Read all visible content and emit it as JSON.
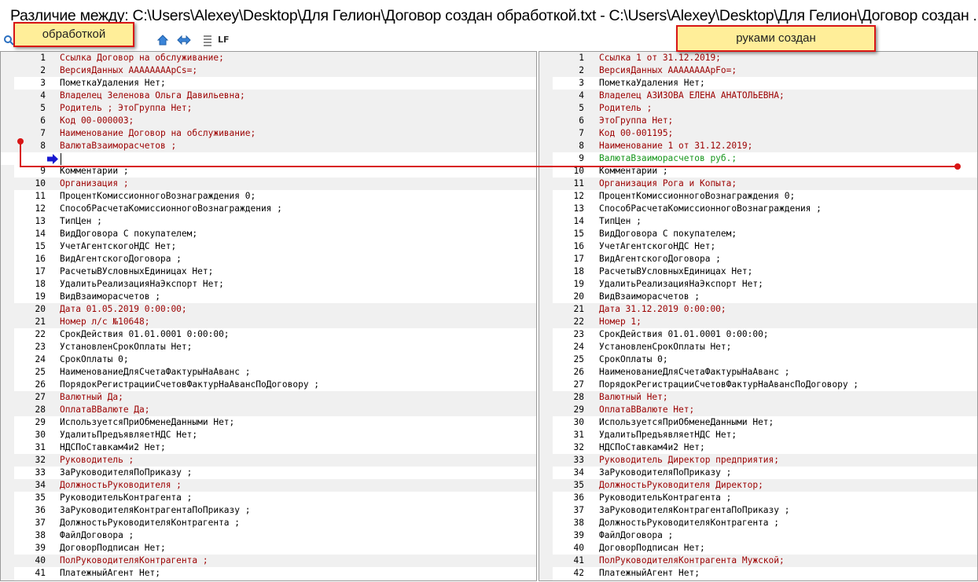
{
  "window": {
    "title": "Различие между: C:\\Users\\Alexey\\Desktop\\Для Гелион\\Договор создан обработкой.txt - C:\\Users\\Alexey\\Desktop\\Для Гелион\\Договор создан ..."
  },
  "toolbar": {
    "lf_label": "LF",
    "icons": [
      "search-icon",
      "home-icon",
      "sync-icon",
      "list-icon"
    ]
  },
  "callouts": {
    "left": "обработкой",
    "right": "руками создан"
  },
  "colors": {
    "diff_text": "#9c0000",
    "added_text": "#16961b",
    "diff_bg": "#f0f0f0",
    "callout_bg": "#ffee99",
    "callout_border": "#d81616",
    "marker_line": "#d81616",
    "cursor_arrow": "#1818d0"
  },
  "left_pane": {
    "lines": [
      {
        "num": "1",
        "text": "Ссылка Договор на обслуживание;",
        "state": "diff"
      },
      {
        "num": "2",
        "text": "ВерсияДанных AAAAAAAApCs=;",
        "state": "diff"
      },
      {
        "num": "3",
        "text": "ПометкаУдаления Нет;",
        "state": "same"
      },
      {
        "num": "4",
        "text": "Владелец Зеленова Ольга Давильевна;",
        "state": "diff"
      },
      {
        "num": "5",
        "text": "Родитель ; ЭтоГруппа Нет;",
        "state": "diff"
      },
      {
        "num": "6",
        "text": "Код 00-000003;",
        "state": "diff"
      },
      {
        "num": "7",
        "text": "Наименование Договор на обслуживание;",
        "state": "diff"
      },
      {
        "num": "8",
        "text": "ВалютаВзаиморасчетов ;",
        "state": "diff"
      },
      {
        "num": "",
        "text": "",
        "state": "blank"
      },
      {
        "num": "9",
        "text": "Комментарии ;",
        "state": "same"
      },
      {
        "num": "10",
        "text": "Организация ;",
        "state": "diff"
      },
      {
        "num": "11",
        "text": "ПроцентКомиссионногоВознаграждения 0;",
        "state": "same"
      },
      {
        "num": "12",
        "text": "СпособРасчетаКомиссионногоВознаграждения ;",
        "state": "same"
      },
      {
        "num": "13",
        "text": "ТипЦен ;",
        "state": "same"
      },
      {
        "num": "14",
        "text": "ВидДоговора С покупателем;",
        "state": "same"
      },
      {
        "num": "15",
        "text": "УчетАгентскогоНДС Нет;",
        "state": "same"
      },
      {
        "num": "16",
        "text": "ВидАгентскогоДоговора ;",
        "state": "same"
      },
      {
        "num": "17",
        "text": "РасчетыВУсловныхЕдиницах Нет;",
        "state": "same"
      },
      {
        "num": "18",
        "text": "УдалитьРеализацияНаЭкспорт Нет;",
        "state": "same"
      },
      {
        "num": "19",
        "text": "ВидВзаиморасчетов ;",
        "state": "same"
      },
      {
        "num": "20",
        "text": "Дата 01.05.2019 0:00:00;",
        "state": "diff"
      },
      {
        "num": "21",
        "text": "Номер л/с №10648;",
        "state": "diff"
      },
      {
        "num": "22",
        "text": "СрокДействия 01.01.0001 0:00:00;",
        "state": "same"
      },
      {
        "num": "23",
        "text": "УстановленСрокОплаты Нет;",
        "state": "same"
      },
      {
        "num": "24",
        "text": "СрокОплаты 0;",
        "state": "same"
      },
      {
        "num": "25",
        "text": "НаименованиеДляСчетаФактурыНаАванс ;",
        "state": "same"
      },
      {
        "num": "26",
        "text": "ПорядокРегистрацииСчетовФактурНаАвансПоДоговору ;",
        "state": "same"
      },
      {
        "num": "27",
        "text": "Валютный Да;",
        "state": "diff"
      },
      {
        "num": "28",
        "text": "ОплатаВВалюте Да;",
        "state": "diff"
      },
      {
        "num": "29",
        "text": "ИспользуетсяПриОбменеДанными Нет;",
        "state": "same"
      },
      {
        "num": "30",
        "text": "УдалитьПредъявляетНДС Нет;",
        "state": "same"
      },
      {
        "num": "31",
        "text": "НДСПоСтавкам4и2 Нет;",
        "state": "same"
      },
      {
        "num": "32",
        "text": "Руководитель ;",
        "state": "diff"
      },
      {
        "num": "33",
        "text": "ЗаРуководителяПоПриказу ;",
        "state": "same"
      },
      {
        "num": "34",
        "text": "ДолжностьРуководителя ;",
        "state": "diff"
      },
      {
        "num": "35",
        "text": "РуководительКонтрагента ;",
        "state": "same"
      },
      {
        "num": "36",
        "text": "ЗаРуководителяКонтрагентаПоПриказу ;",
        "state": "same"
      },
      {
        "num": "37",
        "text": "ДолжностьРуководителяКонтрагента ;",
        "state": "same"
      },
      {
        "num": "38",
        "text": "ФайлДоговора ;",
        "state": "same"
      },
      {
        "num": "39",
        "text": "ДоговорПодписан Нет;",
        "state": "same"
      },
      {
        "num": "40",
        "text": "ПолРуководителяКонтрагента ;",
        "state": "diff"
      },
      {
        "num": "41",
        "text": "ПлатежныйАгент Нет;",
        "state": "same"
      }
    ]
  },
  "right_pane": {
    "lines": [
      {
        "num": "1",
        "text": "Ссылка 1 от 31.12.2019;",
        "state": "diff"
      },
      {
        "num": "2",
        "text": "ВерсияДанных AAAAAAAApFo=;",
        "state": "diff"
      },
      {
        "num": "3",
        "text": "ПометкаУдаления Нет;",
        "state": "same"
      },
      {
        "num": "4",
        "text": "Владелец АЗИЗОВА ЕЛЕНА АНАТОЛЬЕВНА;",
        "state": "diff"
      },
      {
        "num": "5",
        "text": "Родитель ;",
        "state": "diff"
      },
      {
        "num": "6",
        "text": "ЭтоГруппа Нет;",
        "state": "diff"
      },
      {
        "num": "7",
        "text": "Код 00-001195;",
        "state": "diff"
      },
      {
        "num": "8",
        "text": "Наименование 1 от 31.12.2019;",
        "state": "diff"
      },
      {
        "num": "9",
        "text": "ВалютаВзаиморасчетов руб.;",
        "state": "added"
      },
      {
        "num": "10",
        "text": "Комментарии ;",
        "state": "same"
      },
      {
        "num": "11",
        "text": "Организация Рога и Копыта;",
        "state": "diff"
      },
      {
        "num": "12",
        "text": "ПроцентКомиссионногоВознаграждения 0;",
        "state": "same"
      },
      {
        "num": "13",
        "text": "СпособРасчетаКомиссионногоВознаграждения ;",
        "state": "same"
      },
      {
        "num": "14",
        "text": "ТипЦен ;",
        "state": "same"
      },
      {
        "num": "15",
        "text": "ВидДоговора С покупателем;",
        "state": "same"
      },
      {
        "num": "16",
        "text": "УчетАгентскогоНДС Нет;",
        "state": "same"
      },
      {
        "num": "17",
        "text": "ВидАгентскогоДоговора ;",
        "state": "same"
      },
      {
        "num": "18",
        "text": "РасчетыВУсловныхЕдиницах Нет;",
        "state": "same"
      },
      {
        "num": "19",
        "text": "УдалитьРеализацияНаЭкспорт Нет;",
        "state": "same"
      },
      {
        "num": "20",
        "text": "ВидВзаиморасчетов ;",
        "state": "same"
      },
      {
        "num": "21",
        "text": "Дата 31.12.2019 0:00:00;",
        "state": "diff"
      },
      {
        "num": "22",
        "text": "Номер 1;",
        "state": "diff"
      },
      {
        "num": "23",
        "text": "СрокДействия 01.01.0001 0:00:00;",
        "state": "same"
      },
      {
        "num": "24",
        "text": "УстановленСрокОплаты Нет;",
        "state": "same"
      },
      {
        "num": "25",
        "text": "СрокОплаты 0;",
        "state": "same"
      },
      {
        "num": "26",
        "text": "НаименованиеДляСчетаФактурыНаАванс ;",
        "state": "same"
      },
      {
        "num": "27",
        "text": "ПорядокРегистрацииСчетовФактурНаАвансПоДоговору ;",
        "state": "same"
      },
      {
        "num": "28",
        "text": "Валютный Нет;",
        "state": "diff"
      },
      {
        "num": "29",
        "text": "ОплатаВВалюте Нет;",
        "state": "diff"
      },
      {
        "num": "30",
        "text": "ИспользуетсяПриОбменеДанными Нет;",
        "state": "same"
      },
      {
        "num": "31",
        "text": "УдалитьПредъявляетНДС Нет;",
        "state": "same"
      },
      {
        "num": "32",
        "text": "НДСПоСтавкам4и2 Нет;",
        "state": "same"
      },
      {
        "num": "33",
        "text": "Руководитель Директор предприятия;",
        "state": "diff"
      },
      {
        "num": "34",
        "text": "ЗаРуководителяПоПриказу ;",
        "state": "same"
      },
      {
        "num": "35",
        "text": "ДолжностьРуководителя Директор;",
        "state": "diff"
      },
      {
        "num": "36",
        "text": "РуководительКонтрагента ;",
        "state": "same"
      },
      {
        "num": "37",
        "text": "ЗаРуководителяКонтрагентаПоПриказу ;",
        "state": "same"
      },
      {
        "num": "38",
        "text": "ДолжностьРуководителяКонтрагента ;",
        "state": "same"
      },
      {
        "num": "39",
        "text": "ФайлДоговора ;",
        "state": "same"
      },
      {
        "num": "40",
        "text": "ДоговорПодписан Нет;",
        "state": "same"
      },
      {
        "num": "41",
        "text": "ПолРуководителяКонтрагента Мужской;",
        "state": "diff"
      },
      {
        "num": "42",
        "text": "ПлатежныйАгент Нет;",
        "state": "same"
      }
    ]
  }
}
